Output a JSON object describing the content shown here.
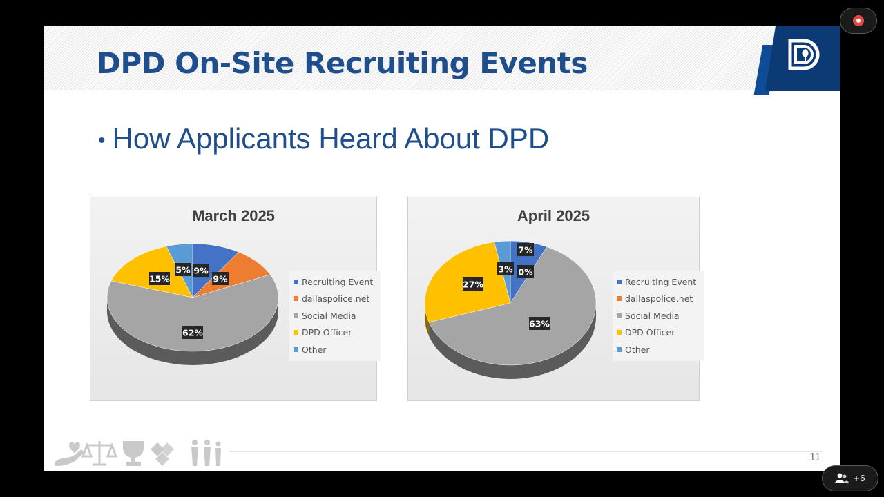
{
  "slide": {
    "title": "DPD On-Site Recruiting Events",
    "bullet": "How Applicants Heard About DPD",
    "page_number": "11"
  },
  "meeting_controls": {
    "participants_count": "+6"
  },
  "legend_labels": [
    "Recruiting Event",
    "dallaspolice.net",
    "Social Media",
    "DPD Officer",
    "Other"
  ],
  "colors": {
    "Recruiting Event": "#4472c4",
    "dallaspolice.net": "#ed7d31",
    "Social Media": "#a5a5a5",
    "DPD Officer": "#ffc000",
    "Other": "#5b9bd5",
    "title_blue": "#1f4e8c",
    "logo_blue": "#0b3a75"
  },
  "icons": [
    "hand-heart-icon",
    "scales-icon",
    "trophy-icon",
    "puzzle-icon",
    "people-icon",
    "record-icon",
    "participants-icon",
    "dpd-logo-icon"
  ],
  "chart_data": [
    {
      "type": "pie",
      "title": "March 2025",
      "categories": [
        "Recruiting Event",
        "dallaspolice.net",
        "Social Media",
        "DPD Officer",
        "Other"
      ],
      "values": [
        9,
        9,
        62,
        15,
        5
      ],
      "labels": [
        "9%",
        "9%",
        "62%",
        "15%",
        "5%"
      ],
      "legend": "right"
    },
    {
      "type": "pie",
      "title": "April 2025",
      "categories": [
        "Recruiting Event",
        "dallaspolice.net",
        "Social Media",
        "DPD Officer",
        "Other"
      ],
      "values": [
        7,
        0,
        63,
        27,
        3
      ],
      "labels": [
        "7%",
        "0%",
        "63%",
        "27%",
        "3%"
      ],
      "legend": "right"
    }
  ]
}
